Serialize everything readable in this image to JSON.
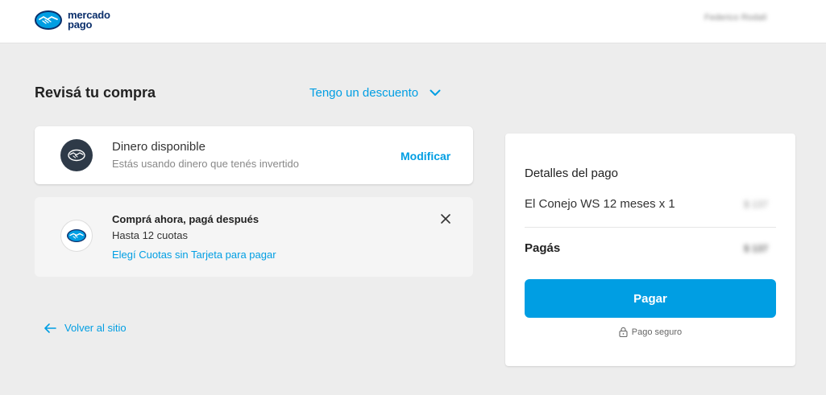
{
  "header": {
    "logo_line1": "mercado",
    "logo_line2": "pago",
    "user_name": "Federico Rodalí"
  },
  "main": {
    "title": "Revisá tu compra",
    "discount_label": "Tengo un descuento",
    "balance_card": {
      "title": "Dinero disponible",
      "subtitle": "Estás usando dinero que tenés invertido",
      "action": "Modificar"
    },
    "promo_card": {
      "title": "Comprá ahora, pagá después",
      "subtitle": "Hasta 12 cuotas",
      "link": "Elegí Cuotas sin Tarjeta para pagar"
    },
    "back_label": "Volver al sitio"
  },
  "summary": {
    "title": "Detalles del pago",
    "item_label": "El Conejo WS 12 meses x 1",
    "item_price": "$ 137",
    "total_label": "Pagás",
    "total_price": "$ 137",
    "pay_button": "Pagar",
    "secure_label": "Pago seguro"
  },
  "colors": {
    "accent": "#009ee3",
    "background": "#ededed",
    "brand_navy": "#0b2f6b"
  }
}
